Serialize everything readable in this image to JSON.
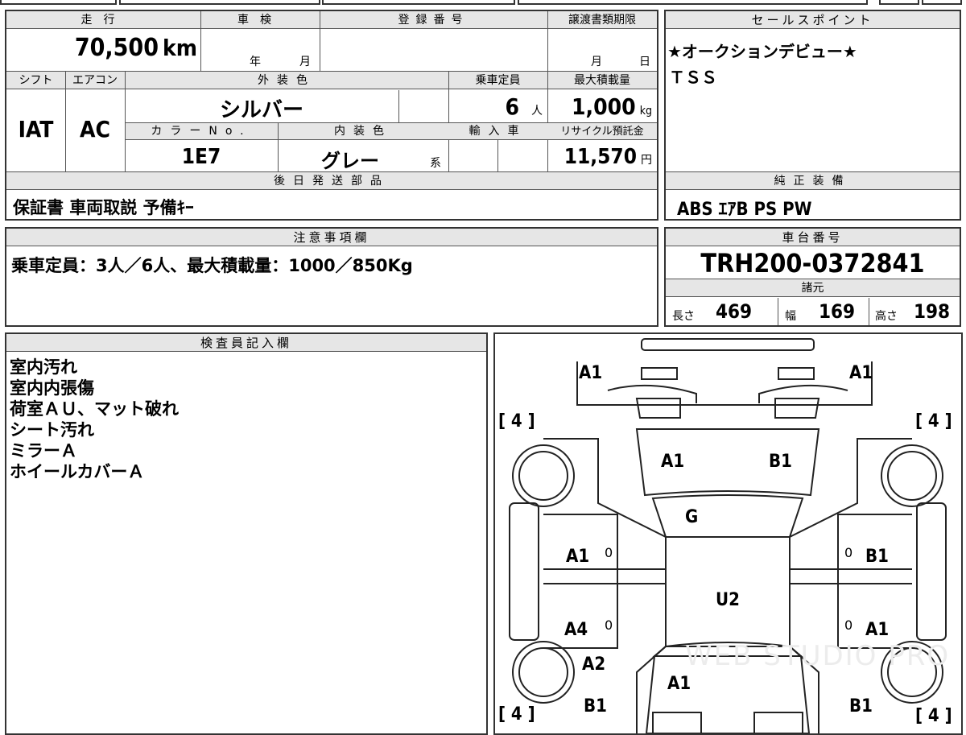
{
  "vehicle": {
    "mileage_label": "走行",
    "mileage": "70,500",
    "mileage_unit": "km",
    "inspection_label": "車検",
    "inspection_year_unit": "年",
    "inspection_month_unit": "月",
    "registration_label": "登録番号",
    "transfer_deadline_label": "譲渡書類期限",
    "transfer_month_unit": "月",
    "transfer_day_unit": "日",
    "shift_label": "シフト",
    "shift": "IAT",
    "ac_label": "エアコン",
    "ac": "AC",
    "exterior_color_label": "外装色",
    "exterior_color": "シルバー",
    "capacity_label": "乗車定員",
    "capacity": "6",
    "capacity_unit": "人",
    "max_load_label": "最大積載量",
    "max_load": "1,000",
    "max_load_unit": "kg",
    "color_no_label": "カラーNo.",
    "color_no": "1E7",
    "interior_color_label": "内装色",
    "interior_color": "グレー",
    "interior_color_suffix": "系",
    "import_label": "輸入車",
    "recycle_label": "リサイクル預託金",
    "recycle_fee": "11,570",
    "recycle_unit": "円",
    "later_parts_label": "後日発送部品",
    "later_parts": "保証書 車両取説 予備ｷｰ"
  },
  "sales_points": {
    "label": "セールスポイント",
    "lines": [
      "★オークションデビュー★",
      "ＴＳＳ"
    ]
  },
  "standard_equipment": {
    "label": "純正装備",
    "value": "ABS ｴｱB PS PW"
  },
  "notes": {
    "label": "注意事項欄",
    "value": "乗車定員：3人／6人、最大積載量：1000／850Kg"
  },
  "chassis": {
    "label": "車台番号",
    "value": "TRH200-0372841",
    "spec_label": "諸元",
    "length_label": "長さ",
    "length": "469",
    "width_label": "幅",
    "width": "169",
    "height_label": "高さ",
    "height": "198"
  },
  "inspector": {
    "label": "検査員記入欄",
    "lines": [
      "室内汚れ",
      "室内内張傷",
      "荷室ＡＵ、マット破れ",
      "シート汚れ",
      "ミラーＡ",
      "ホイールカバーＡ"
    ]
  },
  "diagram": {
    "tire_tl": "[ 4 ]",
    "tire_tr": "[ 4 ]",
    "tire_bl": "[ 4 ]",
    "tire_br": "[ 4 ]",
    "front_left": "A1",
    "front_right": "A1",
    "hood_left": "A1",
    "hood_right": "B1",
    "windshield": "G",
    "roof": "U2",
    "front_door_left": "A1",
    "front_door_right": "B1",
    "rear_door_left": "A4",
    "rear_door_right": "A1",
    "rear_left_quarter": "A2",
    "back": "A1",
    "rear_left": "B1",
    "rear_right": "B1",
    "mark_0": "0",
    "watermark": "WEB STUDIO PRO"
  }
}
